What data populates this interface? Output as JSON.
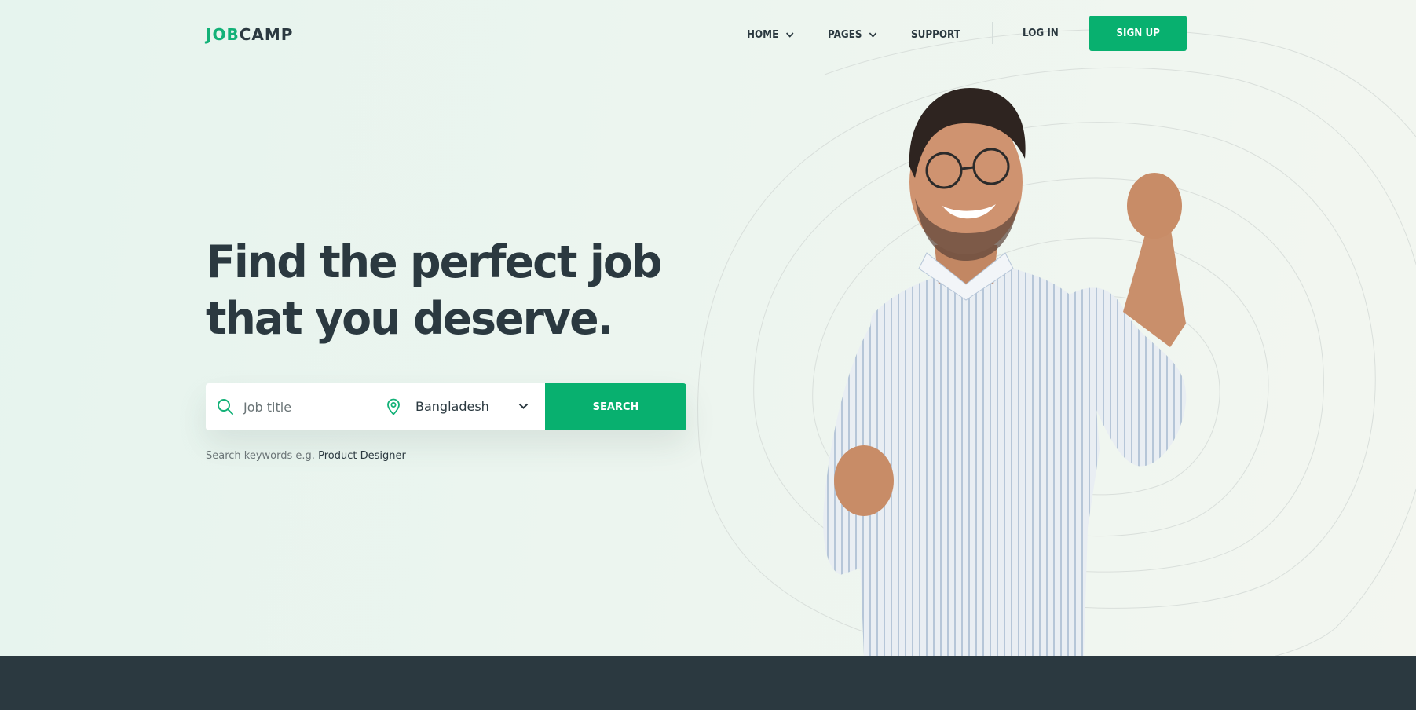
{
  "brand": {
    "accent": "JOB",
    "rest": "CAMP",
    "accent_color": "#12b177",
    "dark_color": "#2b3940"
  },
  "nav": {
    "items": [
      {
        "label": "HOME",
        "dropdown": true
      },
      {
        "label": "PAGES",
        "dropdown": true
      },
      {
        "label": "SUPPORT",
        "dropdown": false
      }
    ],
    "login": "LOG IN",
    "signup": "SIGN UP"
  },
  "hero": {
    "title_line1": "Find the perfect job",
    "title_line2": "that you deserve."
  },
  "search": {
    "job_placeholder": "Job title",
    "location": "Bangladesh",
    "button": "SEARCH"
  },
  "hint": {
    "prefix": "Search keywords e.g.",
    "keyword": "Product Designer"
  },
  "icons": [
    "search-icon",
    "location-pin-icon",
    "chevron-down-icon"
  ],
  "colors": {
    "primary": "#08b06f",
    "footer": "#2b3940",
    "hero_bg": "#e9f5ef"
  }
}
